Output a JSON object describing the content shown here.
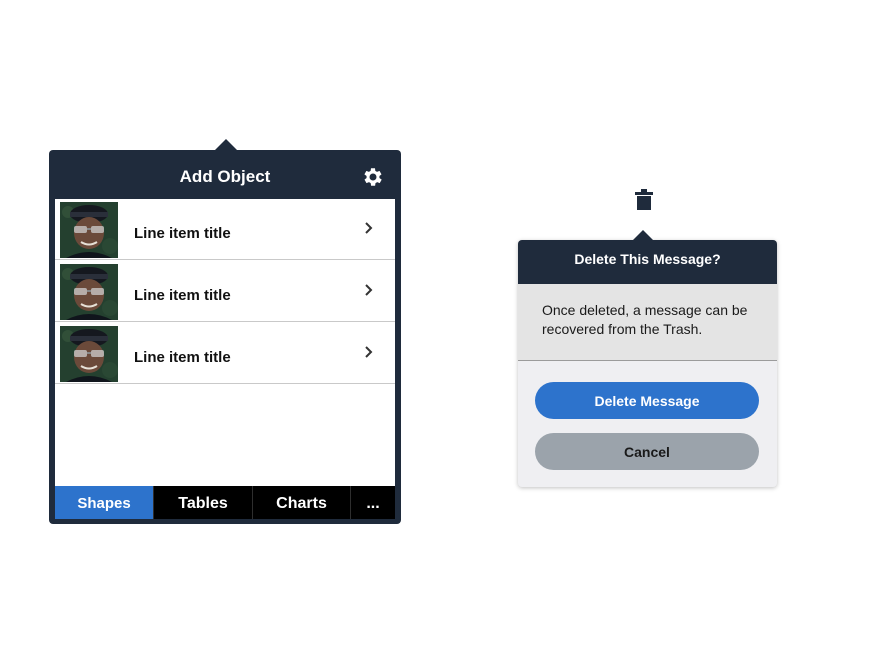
{
  "add_object_popover": {
    "title": "Add Object",
    "settings_icon": "gear-icon",
    "items": [
      {
        "label": "Line item title",
        "thumbnail": "avatar-thumbnail",
        "accessory": "chevron-right-icon"
      },
      {
        "label": "Line item title",
        "thumbnail": "avatar-thumbnail",
        "accessory": "chevron-right-icon"
      },
      {
        "label": "Line item title",
        "thumbnail": "avatar-thumbnail",
        "accessory": "chevron-right-icon"
      }
    ],
    "tabs": [
      {
        "label": "Shapes",
        "active": true
      },
      {
        "label": "Tables",
        "active": false
      },
      {
        "label": "Charts",
        "active": false
      },
      {
        "label": "...",
        "active": false
      }
    ]
  },
  "delete_alert": {
    "anchor_icon": "trash-icon",
    "title": "Delete This Message?",
    "message": "Once deleted, a message can be recovered from the Trash.",
    "primary_button": "Delete Message",
    "cancel_button": "Cancel"
  },
  "colors": {
    "header_dark": "#1f2b3c",
    "accent_blue": "#2d73cc",
    "cancel_gray": "#9ba3ab"
  }
}
